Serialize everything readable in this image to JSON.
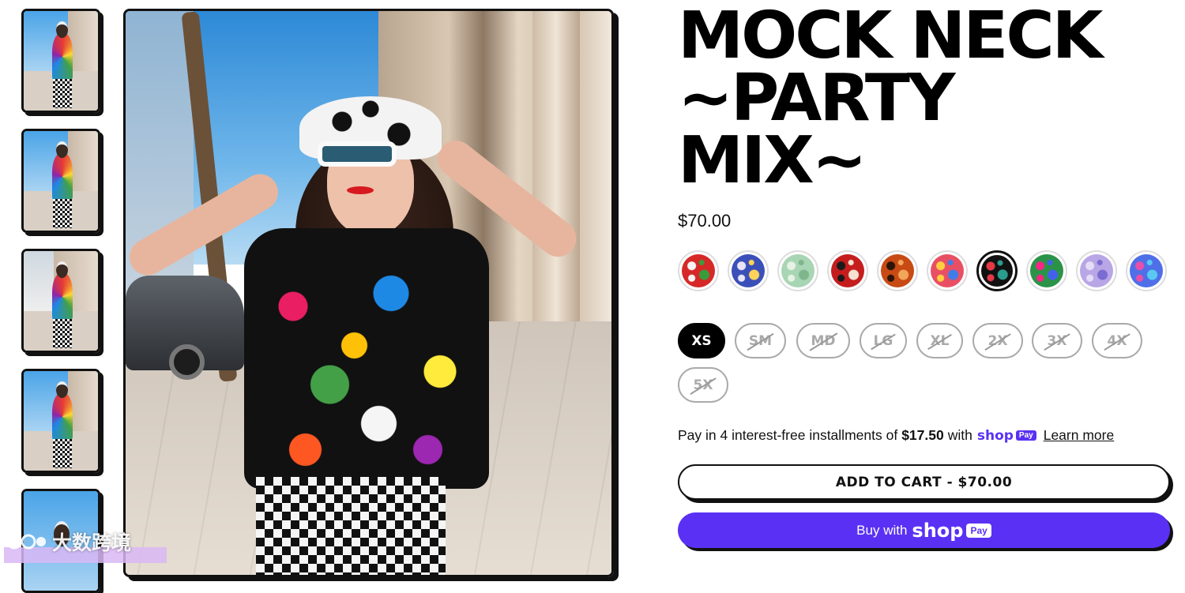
{
  "product": {
    "title_lines": [
      "MOCK NECK",
      "~PARTY",
      "MIX~"
    ],
    "price": "$70.00"
  },
  "swatches": [
    {
      "name": "strawberry-floral",
      "colors": [
        "#d62828",
        "#f4f4f4",
        "#3a9b3a"
      ],
      "selected": false
    },
    {
      "name": "blue-clouds",
      "colors": [
        "#3b4fb8",
        "#e9e4f7",
        "#ffd35a"
      ],
      "selected": false
    },
    {
      "name": "mint-marble",
      "colors": [
        "#a8d5b3",
        "#e6f2e4",
        "#7eb58d"
      ],
      "selected": false
    },
    {
      "name": "red-monsters",
      "colors": [
        "#c51d1d",
        "#1a1a1a",
        "#f5e3d1"
      ],
      "selected": false
    },
    {
      "name": "orange-doodle",
      "colors": [
        "#c84a14",
        "#2a1508",
        "#f2a65a"
      ],
      "selected": false
    },
    {
      "name": "patchwork",
      "colors": [
        "#e94f64",
        "#ffcf3f",
        "#3f7ee8"
      ],
      "selected": false
    },
    {
      "name": "party-mix",
      "colors": [
        "#111111",
        "#e63946",
        "#2a9d8f"
      ],
      "selected": true
    },
    {
      "name": "color-blocks",
      "colors": [
        "#2b9348",
        "#f72585",
        "#4361ee"
      ],
      "selected": false
    },
    {
      "name": "lavender-drip",
      "colors": [
        "#b8a6e6",
        "#e5dcf7",
        "#7b6cd1"
      ],
      "selected": false
    },
    {
      "name": "rainbow-squiggle",
      "colors": [
        "#4f6fe8",
        "#e94fa8",
        "#59c9f2"
      ],
      "selected": false
    }
  ],
  "sizes": [
    {
      "label": "XS",
      "state": "selected"
    },
    {
      "label": "SM",
      "state": "sold"
    },
    {
      "label": "MD",
      "state": "sold"
    },
    {
      "label": "LG",
      "state": "sold"
    },
    {
      "label": "XL",
      "state": "sold"
    },
    {
      "label": "2X",
      "state": "sold"
    },
    {
      "label": "3X",
      "state": "sold"
    },
    {
      "label": "4X",
      "state": "sold"
    },
    {
      "label": "5X",
      "state": "sold"
    }
  ],
  "installments": {
    "prefix": "Pay in 4 interest-free installments of",
    "amount": "$17.50",
    "with": "with",
    "shop": "shop",
    "pay": "Pay",
    "learn_more": "Learn more"
  },
  "buttons": {
    "add_to_cart": "ADD TO CART - $70.00",
    "buy_with": "Buy with",
    "shop": "shop",
    "pay": "Pay"
  },
  "watermark": "大数跨境",
  "colors": {
    "shop_purple": "#5a31f4",
    "ink": "#111111"
  }
}
